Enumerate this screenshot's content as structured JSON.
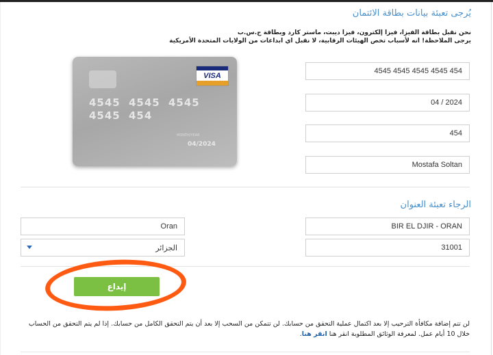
{
  "card_section": {
    "title": "يُرجى تعبئة بيانات بطاقة الائتمان",
    "note_line1": "نحن نقبل بطاقة الفيزا، فيزا إلكترون، فيزا ديبت، ماستر كارد وبطاقة ج.س.ب",
    "note_line2": "يرجى الملاحظة! انه لأسباب تخص الهيئات الرقابية، لا نقبل اي ابداعات من الولايات المتحدة الأمريكية",
    "card_number": "4545 4545 4545 4545 454",
    "expiry": "04 / 2024",
    "cvv": "454",
    "holder_name": "Mostafa Soltan"
  },
  "card_preview": {
    "brand": "VISA",
    "number_display": "4545 4545 4545 4545 454",
    "valid_label": "MONTH/YEAR",
    "expiry_display": "04/2024"
  },
  "address_section": {
    "title": "الرجاء تعبئة العنوان",
    "address": "BIR EL DJIR - ORAN",
    "city": "Oran",
    "postal_code": "31001",
    "country": "الجزائر"
  },
  "submit": {
    "label": "إيداع"
  },
  "footer": {
    "text": "لن تتم إضافة مكافأة الترحيب إلا بعد اكتمال عملية التحقق من حسابك. لن تتمكن من السحب إلا بعد أن يتم التحقق الكامل من حسابك. إذا لم يتم التحقق من الحساب خلال 10 أيام عمل. لمعرفة الوثائق المطلوبة انقر هنا",
    "link": "انقر هنا"
  },
  "colors": {
    "accent": "#4a8fc9",
    "button": "#7cc043",
    "annotation": "#ff5a12"
  }
}
